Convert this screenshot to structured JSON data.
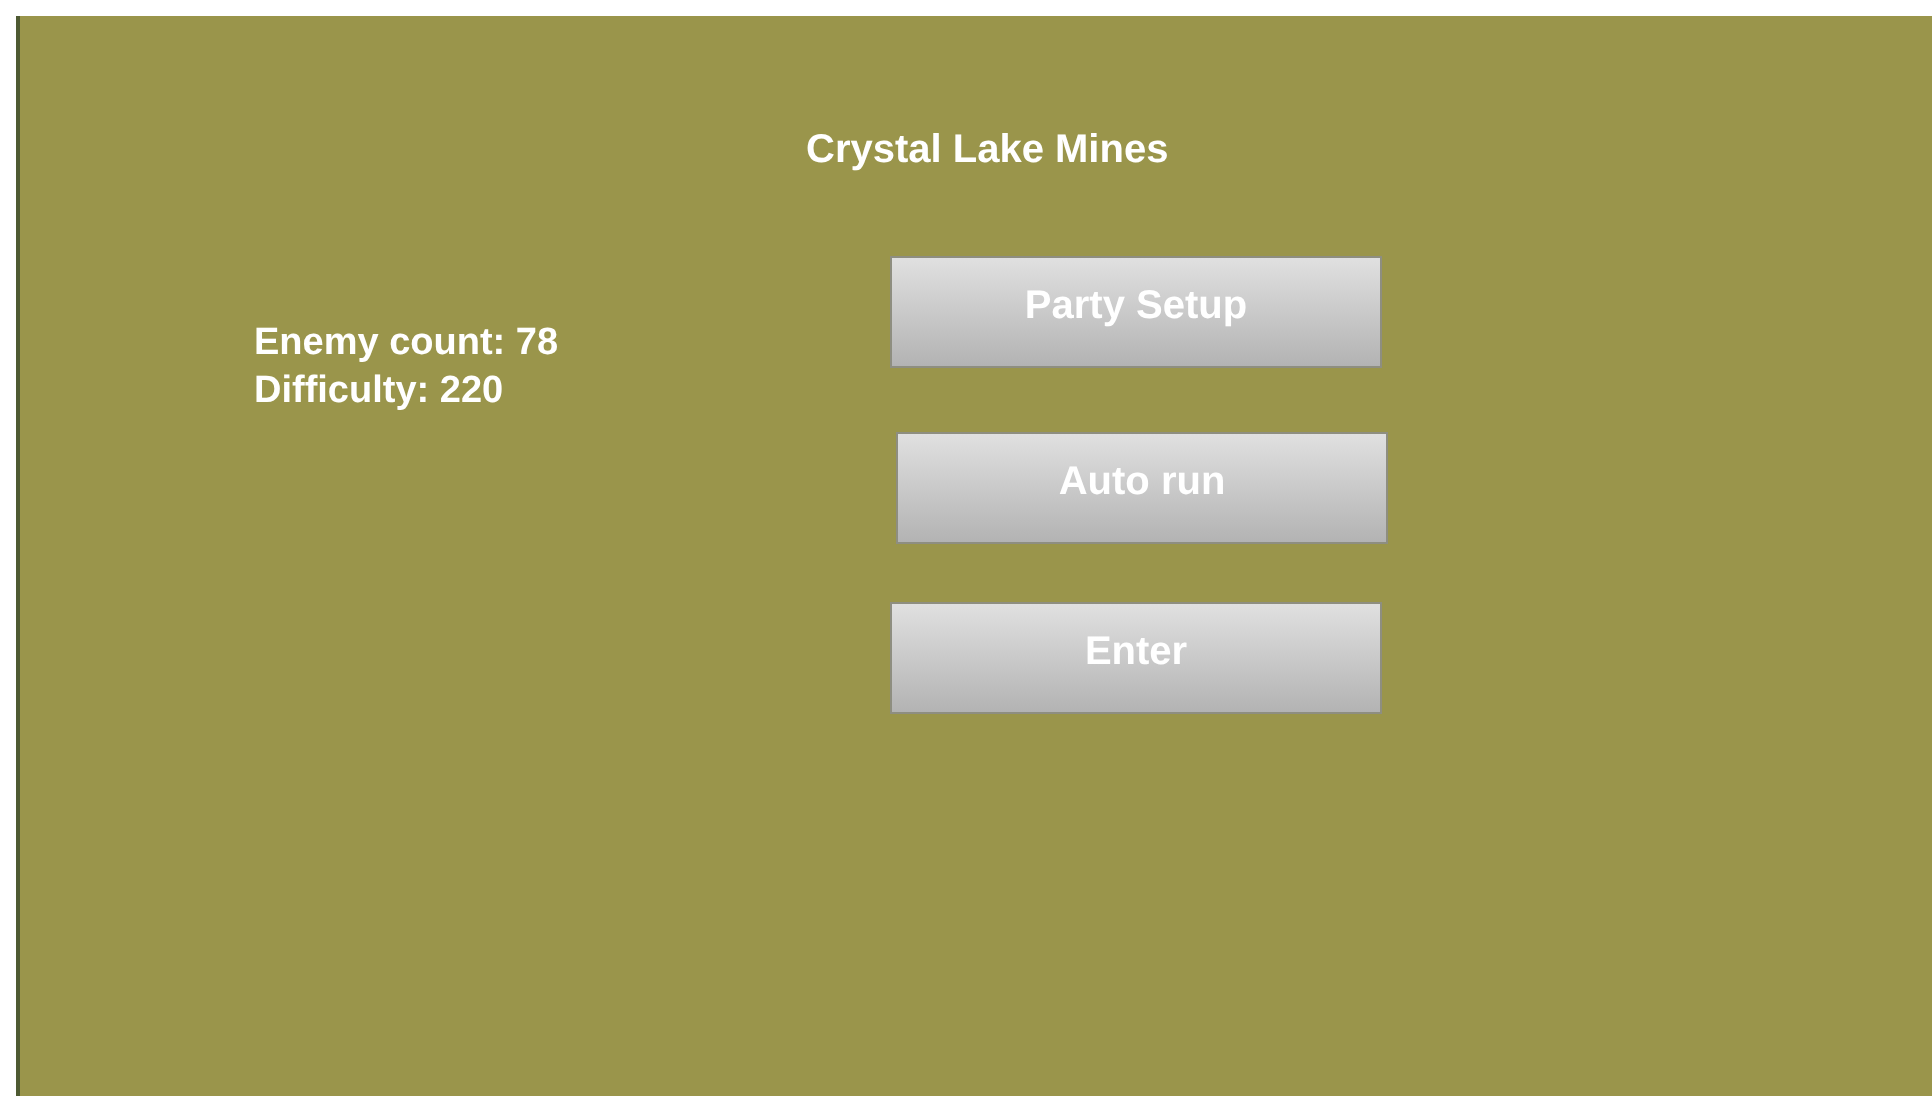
{
  "title": "Crystal Lake Mines",
  "stats": [
    "Enemy count: 78",
    "Difficulty: 220"
  ],
  "buttons": [
    {
      "label": "Party Setup"
    },
    {
      "label": "Auto run"
    },
    {
      "label": "Enter"
    }
  ]
}
